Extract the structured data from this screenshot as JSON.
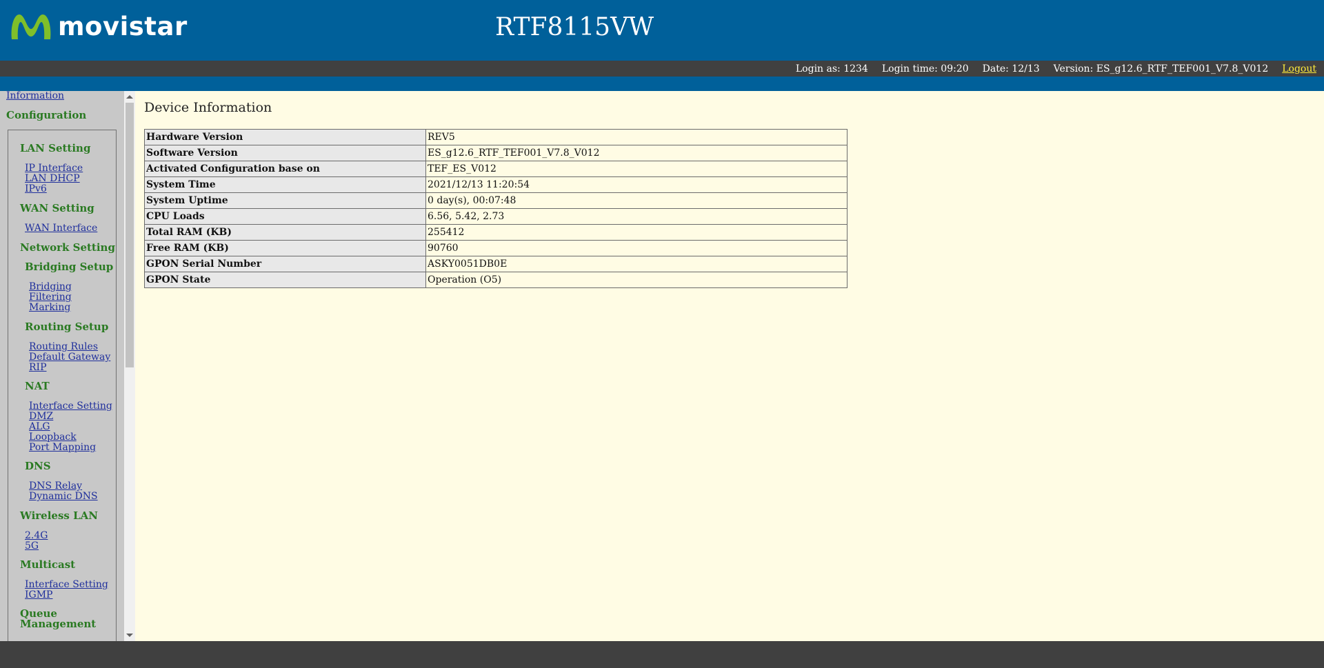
{
  "brand": {
    "name": "movistar"
  },
  "header": {
    "model": "RTF8115VW"
  },
  "status": {
    "login_as": "Login as: 1234",
    "login_time": "Login time: 09:20",
    "date": "Date: 12/13",
    "version": "Version: ES_g12.6_RTF_TEF001_V7.8_V012",
    "logout": "Logout"
  },
  "sidebar": {
    "top_link": "Information",
    "section": "Configuration",
    "groups": [
      {
        "title": "LAN Setting",
        "links": [
          "IP Interface",
          "LAN DHCP",
          "IPv6"
        ]
      },
      {
        "title": "WAN Setting",
        "links": [
          "WAN Interface"
        ]
      },
      {
        "title": "Network Setting",
        "links": []
      },
      {
        "title": "Bridging Setup",
        "links": [
          "Bridging",
          "Filtering",
          "Marking"
        ]
      },
      {
        "title": "Routing Setup",
        "links": [
          "Routing Rules",
          "Default Gateway",
          "RIP"
        ]
      },
      {
        "title": "NAT",
        "links": [
          "Interface Setting",
          "DMZ",
          "ALG",
          "Loopback",
          "Port Mapping"
        ]
      },
      {
        "title": "DNS",
        "links": [
          "DNS Relay",
          "Dynamic DNS"
        ]
      },
      {
        "title": "Wireless LAN",
        "links": [
          "2.4G",
          "5G"
        ]
      },
      {
        "title": "Multicast",
        "links": [
          "Interface Setting",
          "IGMP"
        ]
      },
      {
        "title": "Queue Management",
        "links": []
      }
    ]
  },
  "main": {
    "title": "Device Information",
    "rows": [
      {
        "label": "Hardware Version",
        "value": "REV5"
      },
      {
        "label": "Software Version",
        "value": "ES_g12.6_RTF_TEF001_V7.8_V012"
      },
      {
        "label": "Activated Configuration base on",
        "value": "TEF_ES_V012"
      },
      {
        "label": "System Time",
        "value": "2021/12/13 11:20:54"
      },
      {
        "label": "System Uptime",
        "value": "0 day(s), 00:07:48"
      },
      {
        "label": "CPU Loads",
        "value": "6.56, 5.42, 2.73"
      },
      {
        "label": "Total RAM (KB)",
        "value": "255412"
      },
      {
        "label": "Free RAM (KB)",
        "value": "90760"
      },
      {
        "label": "GPON Serial Number",
        "value": "ASKY0051DB0E"
      },
      {
        "label": "GPON State",
        "value": "Operation (O5)"
      }
    ]
  }
}
